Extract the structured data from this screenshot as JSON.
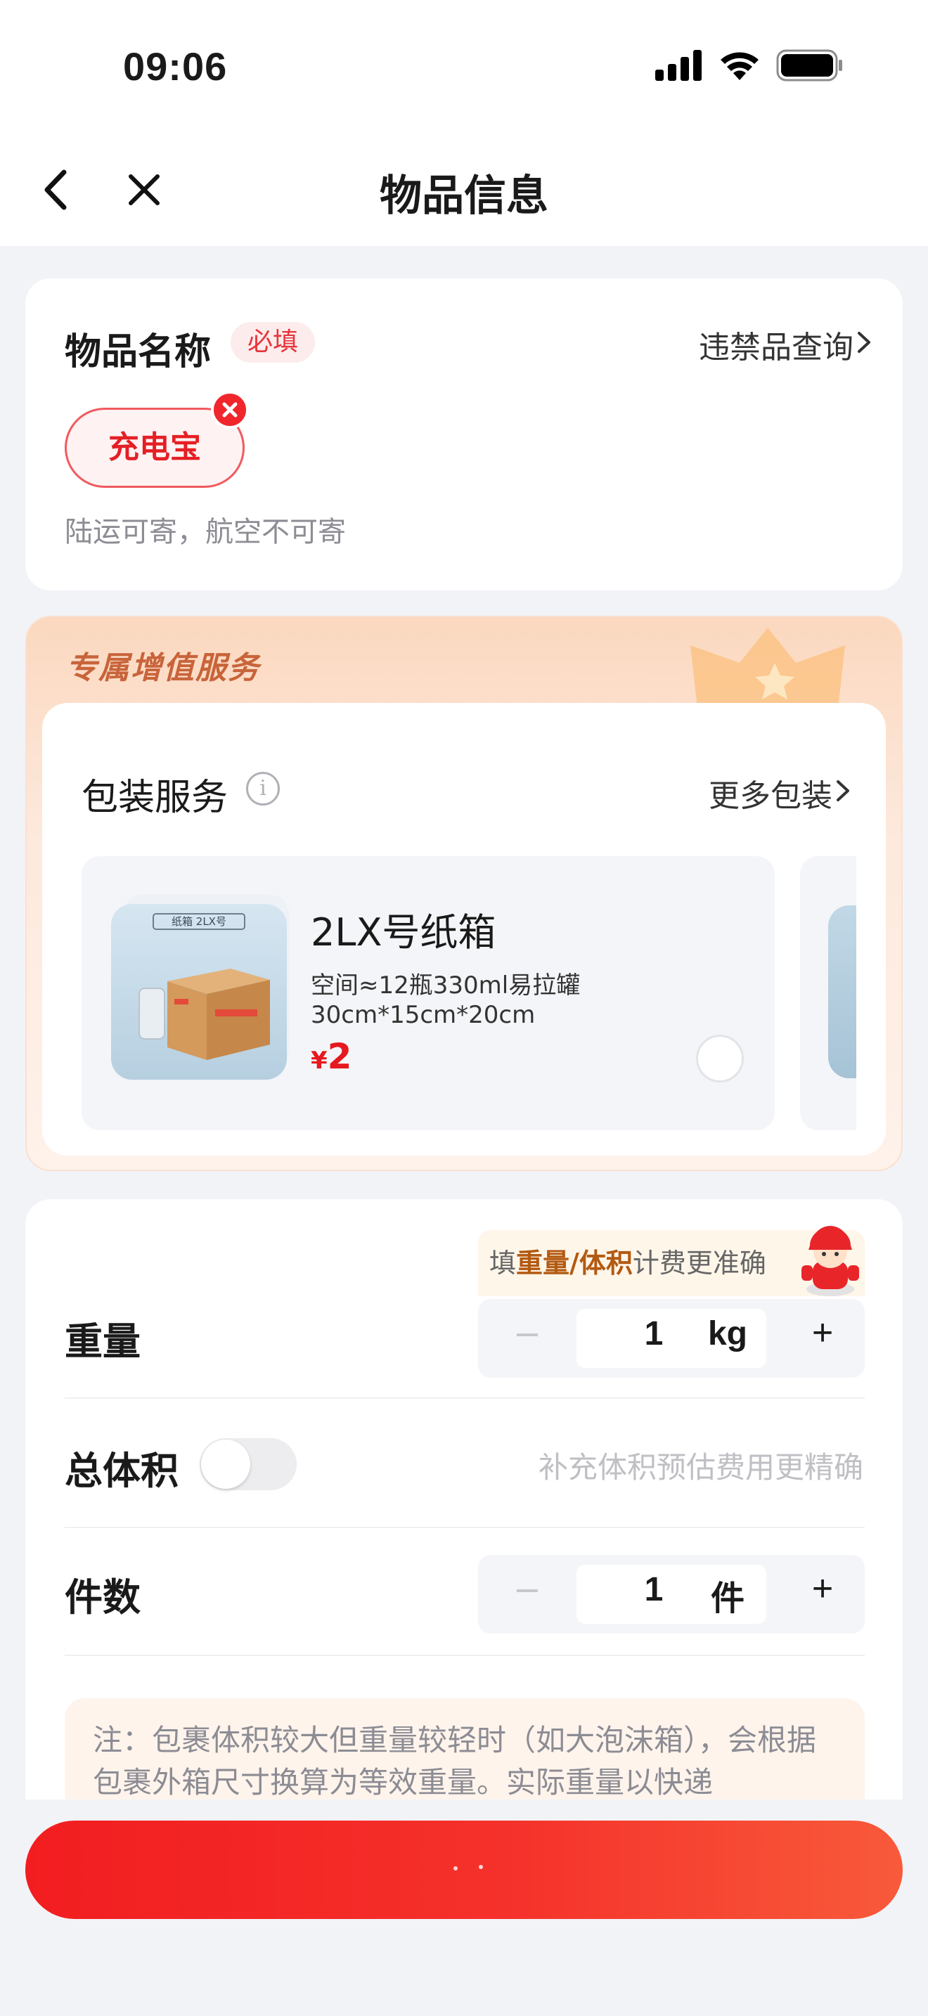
{
  "status_bar": {
    "time": "09:06"
  },
  "nav": {
    "title": "物品信息"
  },
  "item_card": {
    "title": "物品名称",
    "required_badge": "必填",
    "prohibited_link": "违禁品查询",
    "selected_item": "充电宝",
    "note": "陆运可寄，航空不可寄"
  },
  "service_card": {
    "header": "专属增值服务",
    "packaging": {
      "title": "包装服务",
      "more_link": "更多包装",
      "option": {
        "name": "2LX号纸箱",
        "capacity": "空间≈12瓶330ml易拉罐",
        "size": "30cm*15cm*20cm",
        "currency": "¥",
        "price": "2",
        "thumb_label": "纸箱 2LX号",
        "selected": false
      }
    }
  },
  "measure_card": {
    "tip_prefix": "填",
    "tip_highlight": "重量/体积",
    "tip_suffix": "计费更准确",
    "weight": {
      "label": "重量",
      "value": "1",
      "unit": "kg"
    },
    "volume": {
      "label": "总体积",
      "hint": "补充体积预估费用更精确",
      "enabled": false
    },
    "count": {
      "label": "件数",
      "value": "1",
      "unit": "件"
    },
    "note": "注：包裹体积较大但重量较轻时（如大泡沫箱），会根据包裹外箱尺寸换算为等效重量。实际重量以快递"
  },
  "submit": {
    "label": ""
  },
  "colors": {
    "accent": "#e5191f",
    "accent_orange": "#c8643a",
    "page_bg": "#f2f3f7"
  }
}
